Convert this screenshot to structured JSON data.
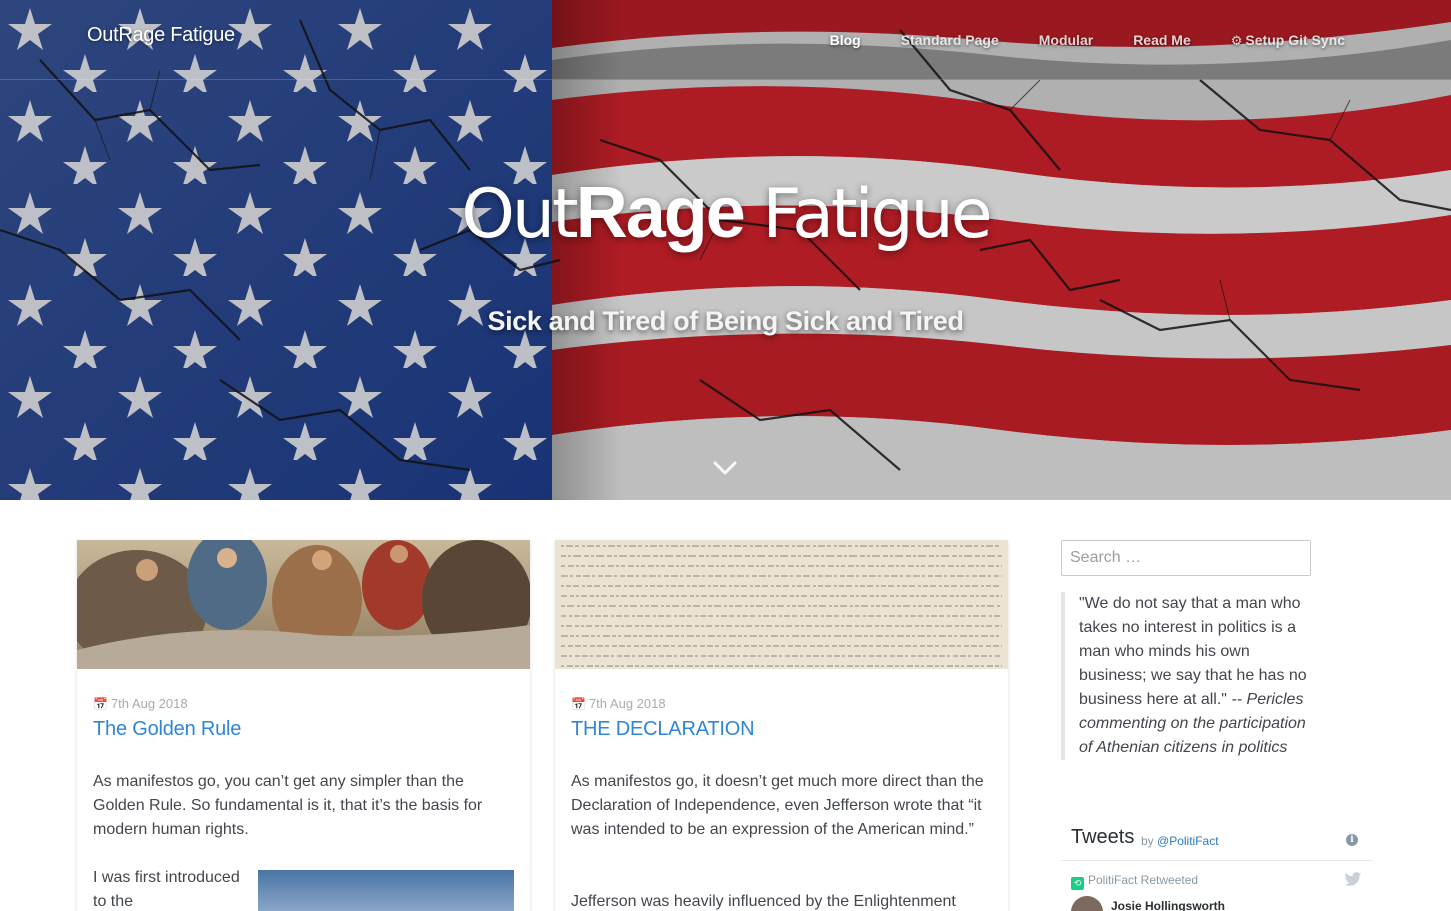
{
  "site": {
    "logo_light": "Out",
    "logo_strong": "Rage",
    "logo_rest": " Fatigue"
  },
  "nav": {
    "items": [
      {
        "label": "Blog",
        "active": true
      },
      {
        "label": "Standard Page",
        "active": false
      },
      {
        "label": "Modular",
        "active": false
      },
      {
        "label": "Read Me",
        "active": false
      },
      {
        "label": "Setup Git Sync",
        "active": false,
        "icon": "gear-icon"
      }
    ]
  },
  "hero": {
    "title_light": "Out",
    "title_bold": "Rage",
    "title_rest": " Fatigue",
    "subtitle": "Sick and Tired of Being Sick and Tired",
    "scroll_icon": "chevron-down-icon"
  },
  "posts": [
    {
      "date": "7th Aug 2018",
      "title": "The Golden Rule",
      "body": "As manifestos go, you can’t get any simpler than the Golden Rule. So fundamental is it, that it’s the basis for modern human rights.",
      "body2": "I was first introduced to the"
    },
    {
      "date": "7th Aug 2018",
      "title": "THE DECLARATION",
      "body": "As manifestos go, it doesn’t get much more direct than the Declaration of Independence, even Jefferson wrote that “it was intended to be an expression of the American mind.”",
      "body2": "Jefferson was heavily influenced by the Enlightenment"
    }
  ],
  "sidebar": {
    "search_placeholder": "Search …",
    "quote_text": "\"We do not say that a man who takes no interest in politics is a man who minds his own business; we say that he has no business here at all.\"",
    "quote_attrib": " -- Pericles commenting on the participation of Athenian citizens in politics",
    "tweets_title": "Tweets",
    "tweets_by": "by ",
    "tweets_handle": "@PolitiFact",
    "retweet_label": "PolitiFact Retweeted",
    "tweet_author": "Josie Hollingsworth"
  },
  "colors": {
    "link": "#2f86d6",
    "flag_blue": "#1f3f8a",
    "flag_red": "#c8202a",
    "retweet_green": "#19cf86"
  }
}
